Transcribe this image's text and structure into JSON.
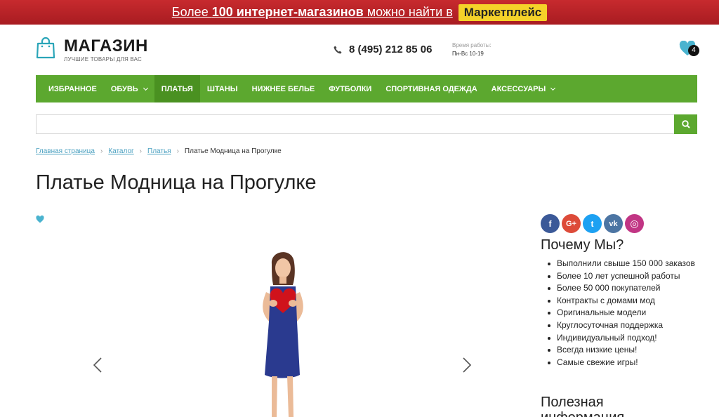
{
  "promo": {
    "text_before": "Более ",
    "text_bold1": "100 интернет-магазинов",
    "text_after": " можно найти в",
    "badge": "Маркетплейс"
  },
  "header": {
    "logo_title": "МАГАЗИН",
    "logo_subtitle": "ЛУЧШИЕ ТОВАРЫ ДЛЯ ВАС",
    "phone": "8 (495) 212 85 06",
    "hours_label": "Время работы:",
    "hours_value": "Пн-Вс 10-19",
    "favorites_count": "4"
  },
  "nav": {
    "items": [
      {
        "label": "ИЗБРАННОЕ"
      },
      {
        "label": "ОБУВЬ"
      },
      {
        "label": "ПЛАТЬЯ"
      },
      {
        "label": "ШТАНЫ"
      },
      {
        "label": "НИЖНЕЕ БЕЛЬЕ"
      },
      {
        "label": "ФУТБОЛКИ"
      },
      {
        "label": "СПОРТИВНАЯ ОДЕЖДА"
      },
      {
        "label": "АКСЕССУАРЫ"
      }
    ]
  },
  "search": {
    "value": "",
    "placeholder": ""
  },
  "breadcrumb": {
    "items": [
      {
        "label": "Главная страница"
      },
      {
        "label": "Каталог"
      },
      {
        "label": "Платья"
      }
    ],
    "current": "Платье Модница на Прогулке"
  },
  "product": {
    "title": "Платье Модница на Прогулке"
  },
  "sidebar": {
    "social": [
      {
        "name": "facebook",
        "glyph": "f",
        "color": "#3b5998"
      },
      {
        "name": "google-plus",
        "glyph": "G+",
        "color": "#dd4b39"
      },
      {
        "name": "twitter",
        "glyph": "t",
        "color": "#1da1f2"
      },
      {
        "name": "vk",
        "glyph": "vk",
        "color": "#4c75a3"
      },
      {
        "name": "instagram",
        "glyph": "◎",
        "color": "#c13584"
      }
    ],
    "why_title": "Почему Мы?",
    "why_items": [
      "Выполнили свыше 150 000 заказов",
      "Более 10 лет успешной работы",
      "Более 50 000 покупателей",
      "Контракты с домами мод",
      "Оригинальные модели",
      "Круглосуточная поддержка",
      "Индивидуальный подход!",
      "Всегда низкие цены!",
      "Самые свежие игры!"
    ],
    "info_title": "Полезная информация"
  },
  "colors": {
    "accent_green": "#5ca82f",
    "promo_red": "#b52226",
    "link_blue": "#4aa0c0",
    "heart_blue": "#4ab3cf"
  }
}
